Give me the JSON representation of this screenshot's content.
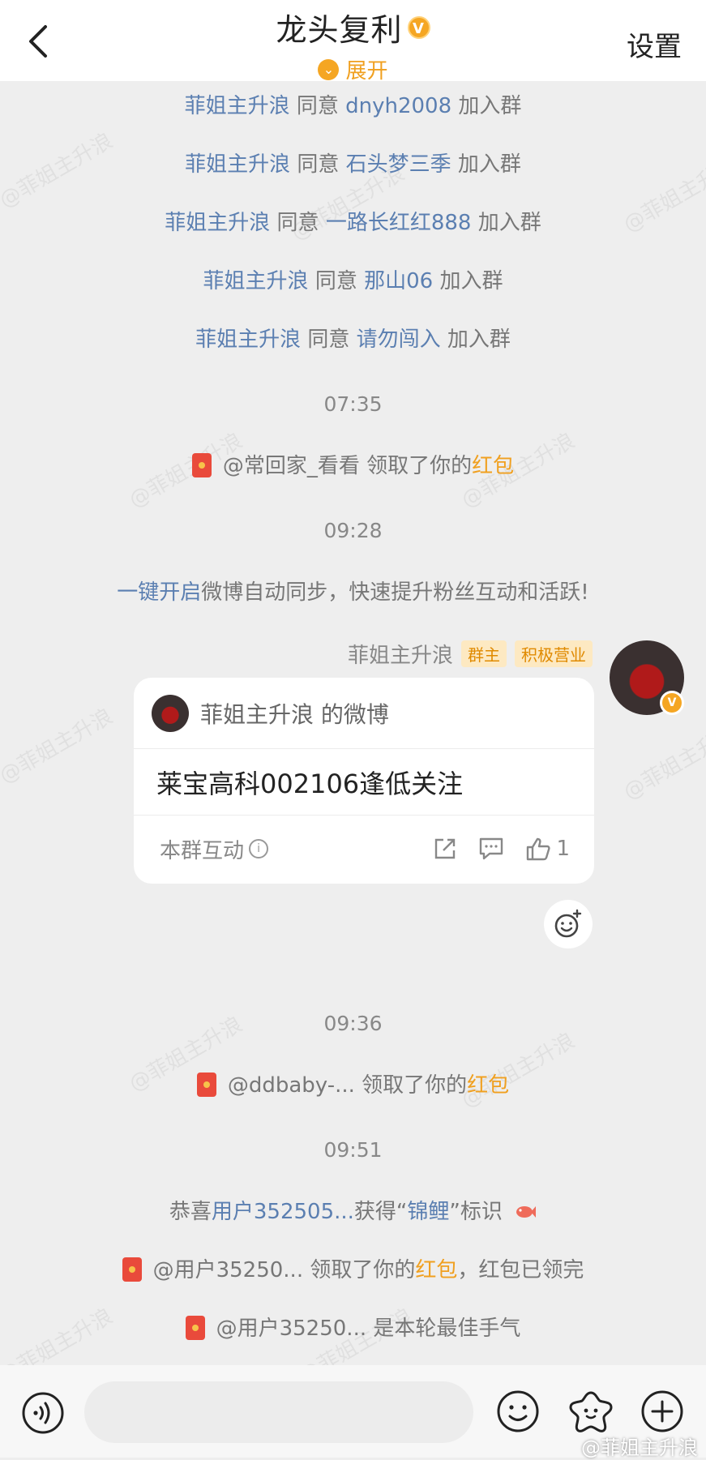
{
  "header": {
    "title": "龙头复利",
    "expand_label": "展开",
    "settings_label": "设置",
    "verified_badge": "V"
  },
  "watermark": "@菲姐主升浪",
  "join_events": [
    {
      "actor": "菲姐主升浪",
      "verb": "同意",
      "user": "dnyh2008",
      "suffix": "加入群"
    },
    {
      "actor": "菲姐主升浪",
      "verb": "同意",
      "user": "石头梦三季",
      "suffix": "加入群"
    },
    {
      "actor": "菲姐主升浪",
      "verb": "同意",
      "user": "一路长红红888",
      "suffix": "加入群"
    },
    {
      "actor": "菲姐主升浪",
      "verb": "同意",
      "user": "那山06",
      "suffix": "加入群"
    },
    {
      "actor": "菲姐主升浪",
      "verb": "同意",
      "user": "请勿闯入",
      "suffix": "加入群"
    }
  ],
  "times": [
    "07:35",
    "09:28",
    "09:36",
    "09:51"
  ],
  "redpacket_1": {
    "user": "@常回家_看看",
    "text": "领取了你的",
    "highlight": "红包"
  },
  "sync_notice": {
    "link": "一键开启",
    "text": "微博自动同步，快速提升粉丝互动和活跃!"
  },
  "message": {
    "sender": "菲姐主升浪",
    "tags": [
      "群主",
      "积极营业"
    ],
    "card_title": "菲姐主升浪 的微博",
    "card_body": "莱宝高科002106逢低关注",
    "footer_label": "本群互动",
    "like_count": "1"
  },
  "redpacket_2": {
    "user": "@ddbaby-...",
    "text": "领取了你的",
    "highlight": "红包"
  },
  "koi_notice": {
    "prefix": "恭喜",
    "user": "用户352505...",
    "middle": "获得“",
    "badge": "锦鲤",
    "suffix": "”标识"
  },
  "redpacket_3": {
    "user": "@用户35250...",
    "text": "领取了你的",
    "highlight": "红包",
    "tail": "，红包已领完"
  },
  "redpacket_4": {
    "user": "@用户35250...",
    "text": "是本轮最佳手气"
  },
  "credit": "@菲姐主升浪",
  "colors": {
    "link_blue": "#5b7fb1",
    "accent_orange": "#f0a020",
    "redpacket": "#e94a3b"
  }
}
